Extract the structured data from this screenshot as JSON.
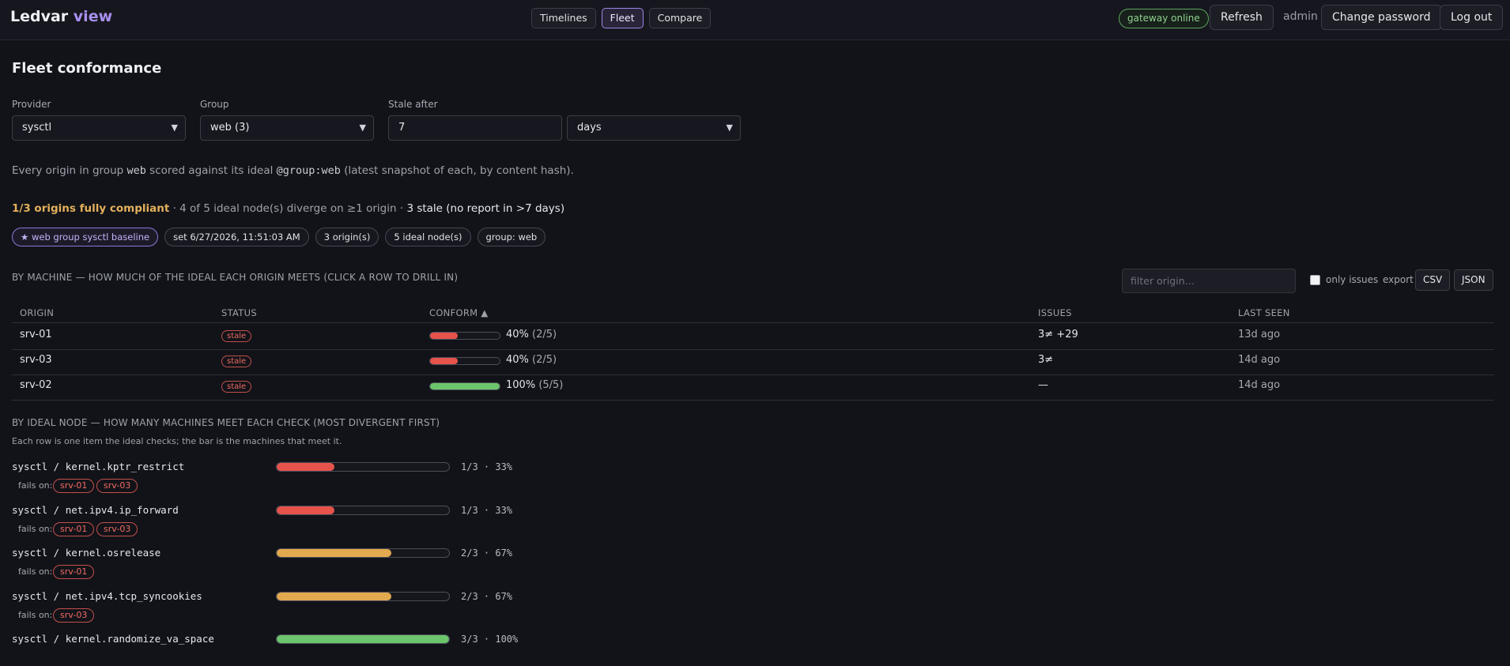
{
  "header": {
    "brand_main": "Ledvar",
    "brand_accent": "view",
    "nav": [
      "Timelines",
      "Fleet",
      "Compare"
    ],
    "active_nav": "Fleet",
    "gateway_status": "gateway online",
    "refresh": "Refresh",
    "user": "admin",
    "change_password": "Change password",
    "logout": "Log out"
  },
  "page": {
    "title": "Fleet conformance"
  },
  "filters": {
    "provider_label": "Provider",
    "provider_value": "sysctl",
    "group_label": "Group",
    "group_value": "web (3)",
    "stale_label": "Stale after",
    "stale_value": "7",
    "stale_unit": "days"
  },
  "description": {
    "pre": "Every origin in group ",
    "group": "web",
    "mid": " scored against its ideal ",
    "ideal": "@group:web",
    "post": " (latest snapshot of each, by content hash)."
  },
  "summary": {
    "compliant": "1/3 origins fully compliant",
    "diverge": " · 4 of 5 ideal node(s) diverge on ≥1 origin · ",
    "stale": "3 stale (no report in >7 days)"
  },
  "chips": [
    "★ web group sysctl baseline",
    "set 6/27/2026, 11:51:03 AM",
    "3 origin(s)",
    "5 ideal node(s)",
    "group: web"
  ],
  "machines": {
    "section_title": "BY MACHINE — HOW MUCH OF THE IDEAL EACH ORIGIN MEETS (CLICK A ROW TO DRILL IN)",
    "filter_placeholder": "filter origin…",
    "only_issues": "only issues",
    "export_label": "export",
    "csv": "CSV",
    "json": "JSON",
    "columns": [
      "ORIGIN",
      "STATUS",
      "CONFORM ▲",
      "ISSUES",
      "LAST SEEN"
    ],
    "rows": [
      {
        "origin": "srv-01",
        "status": "stale",
        "conform": 0.4,
        "pct": "40%",
        "frac": "(2/5)",
        "issues": "3≠ +29",
        "last_seen": "13d ago",
        "color": "#e5534b"
      },
      {
        "origin": "srv-03",
        "status": "stale",
        "conform": 0.4,
        "pct": "40%",
        "frac": "(2/5)",
        "issues": "3≠",
        "last_seen": "14d ago",
        "color": "#e5534b"
      },
      {
        "origin": "srv-02",
        "status": "stale",
        "conform": 1.0,
        "pct": "100%",
        "frac": "(5/5)",
        "issues": "—",
        "last_seen": "14d ago",
        "color": "#6cc56c"
      }
    ]
  },
  "nodes": {
    "section_title": "BY IDEAL NODE — HOW MANY MACHINES MEET EACH CHECK (MOST DIVERGENT FIRST)",
    "note": "Each row is one item the ideal checks; the bar is the machines that meet it.",
    "fails_on_label": "fails on:",
    "rows": [
      {
        "name": "sysctl / kernel.kptr_restrict",
        "ratio": 0.333,
        "count": "1/3 · 33%",
        "color": "#e5534b",
        "fails": [
          "srv-01",
          "srv-03"
        ]
      },
      {
        "name": "sysctl / net.ipv4.ip_forward",
        "ratio": 0.333,
        "count": "1/3 · 33%",
        "color": "#e5534b",
        "fails": [
          "srv-01",
          "srv-03"
        ]
      },
      {
        "name": "sysctl / kernel.osrelease",
        "ratio": 0.667,
        "count": "2/3 · 67%",
        "color": "#e3a94f",
        "fails": [
          "srv-01"
        ]
      },
      {
        "name": "sysctl / net.ipv4.tcp_syncookies",
        "ratio": 0.667,
        "count": "2/3 · 67%",
        "color": "#e3a94f",
        "fails": [
          "srv-03"
        ]
      },
      {
        "name": "sysctl / kernel.randomize_va_space",
        "ratio": 1.0,
        "count": "3/3 · 100%",
        "color": "#6cc56c",
        "fails": []
      }
    ]
  }
}
